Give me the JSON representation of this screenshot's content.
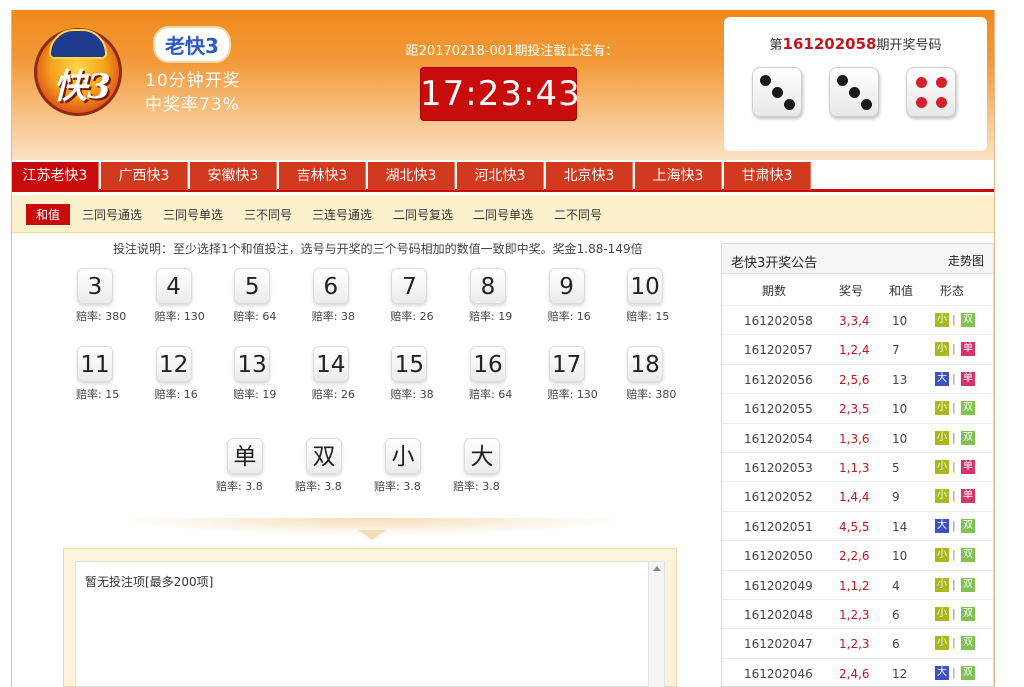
{
  "header": {
    "logo_text": "快3",
    "brand": "老快3",
    "subtitle1": "10分钟开奖",
    "subtitle2": "中奖率73%",
    "countdown_label": "距20170218-001期投注截止还有：",
    "countdown": "17:23:43",
    "draw_prefix": "第",
    "draw_issue": "161202058",
    "draw_suffix": "期开奖号码",
    "dice_values": [
      3,
      3,
      4
    ]
  },
  "tabs": [
    "江苏老快3",
    "广西快3",
    "安徽快3",
    "吉林快3",
    "湖北快3",
    "河北快3",
    "北京快3",
    "上海快3",
    "甘肃快3"
  ],
  "subtabs": [
    "和值",
    "三同号通选",
    "三同号单选",
    "三不同号",
    "三连号通选",
    "二同号复选",
    "二同号单选",
    "二不同号"
  ],
  "instruction": "投注说明：至少选择1个和值投注，选号与开奖的三个号码相加的数值一致即中奖。奖金1.88-149倍",
  "sum_bets": [
    {
      "num": "3",
      "odds": "赔率: 380"
    },
    {
      "num": "4",
      "odds": "赔率: 130"
    },
    {
      "num": "5",
      "odds": "赔率: 64"
    },
    {
      "num": "6",
      "odds": "赔率: 38"
    },
    {
      "num": "7",
      "odds": "赔率: 26"
    },
    {
      "num": "8",
      "odds": "赔率: 19"
    },
    {
      "num": "9",
      "odds": "赔率: 16"
    },
    {
      "num": "10",
      "odds": "赔率: 15"
    },
    {
      "num": "11",
      "odds": "赔率: 15"
    },
    {
      "num": "12",
      "odds": "赔率: 16"
    },
    {
      "num": "13",
      "odds": "赔率: 19"
    },
    {
      "num": "14",
      "odds": "赔率: 26"
    },
    {
      "num": "15",
      "odds": "赔率: 38"
    },
    {
      "num": "16",
      "odds": "赔率: 64"
    },
    {
      "num": "17",
      "odds": "赔率: 130"
    },
    {
      "num": "18",
      "odds": "赔率: 380"
    }
  ],
  "type_bets": [
    {
      "label": "单",
      "odds": "赔率: 3.8"
    },
    {
      "label": "双",
      "odds": "赔率: 3.8"
    },
    {
      "label": "小",
      "odds": "赔率: 3.8"
    },
    {
      "label": "大",
      "odds": "赔率: 3.8"
    }
  ],
  "bet_list_placeholder": "暂无投注项[最多200项]",
  "sidebar": {
    "title": "老快3开奖公告",
    "chart_link": "走势图",
    "columns": [
      "期数",
      "奖号",
      "和值",
      "形态"
    ],
    "rows": [
      {
        "issue": "161202058",
        "nums": "3,3,4",
        "sum": "10",
        "size": "小",
        "parity": "双"
      },
      {
        "issue": "161202057",
        "nums": "1,2,4",
        "sum": "7",
        "size": "小",
        "parity": "单"
      },
      {
        "issue": "161202056",
        "nums": "2,5,6",
        "sum": "13",
        "size": "大",
        "parity": "单"
      },
      {
        "issue": "161202055",
        "nums": "2,3,5",
        "sum": "10",
        "size": "小",
        "parity": "双"
      },
      {
        "issue": "161202054",
        "nums": "1,3,6",
        "sum": "10",
        "size": "小",
        "parity": "双"
      },
      {
        "issue": "161202053",
        "nums": "1,1,3",
        "sum": "5",
        "size": "小",
        "parity": "单"
      },
      {
        "issue": "161202052",
        "nums": "1,4,4",
        "sum": "9",
        "size": "小",
        "parity": "单"
      },
      {
        "issue": "161202051",
        "nums": "4,5,5",
        "sum": "14",
        "size": "大",
        "parity": "双"
      },
      {
        "issue": "161202050",
        "nums": "2,2,6",
        "sum": "10",
        "size": "小",
        "parity": "双"
      },
      {
        "issue": "161202049",
        "nums": "1,1,2",
        "sum": "4",
        "size": "小",
        "parity": "双"
      },
      {
        "issue": "161202048",
        "nums": "1,2,3",
        "sum": "6",
        "size": "小",
        "parity": "双"
      },
      {
        "issue": "161202047",
        "nums": "1,2,3",
        "sum": "6",
        "size": "小",
        "parity": "双"
      },
      {
        "issue": "161202046",
        "nums": "2,4,6",
        "sum": "12",
        "size": "大",
        "parity": "双"
      }
    ]
  },
  "colors": {
    "small": "#a9b81c",
    "big": "#3a52c4",
    "odd": "#d6336c",
    "even": "#7fc24f",
    "accent": "#c80c0c"
  }
}
